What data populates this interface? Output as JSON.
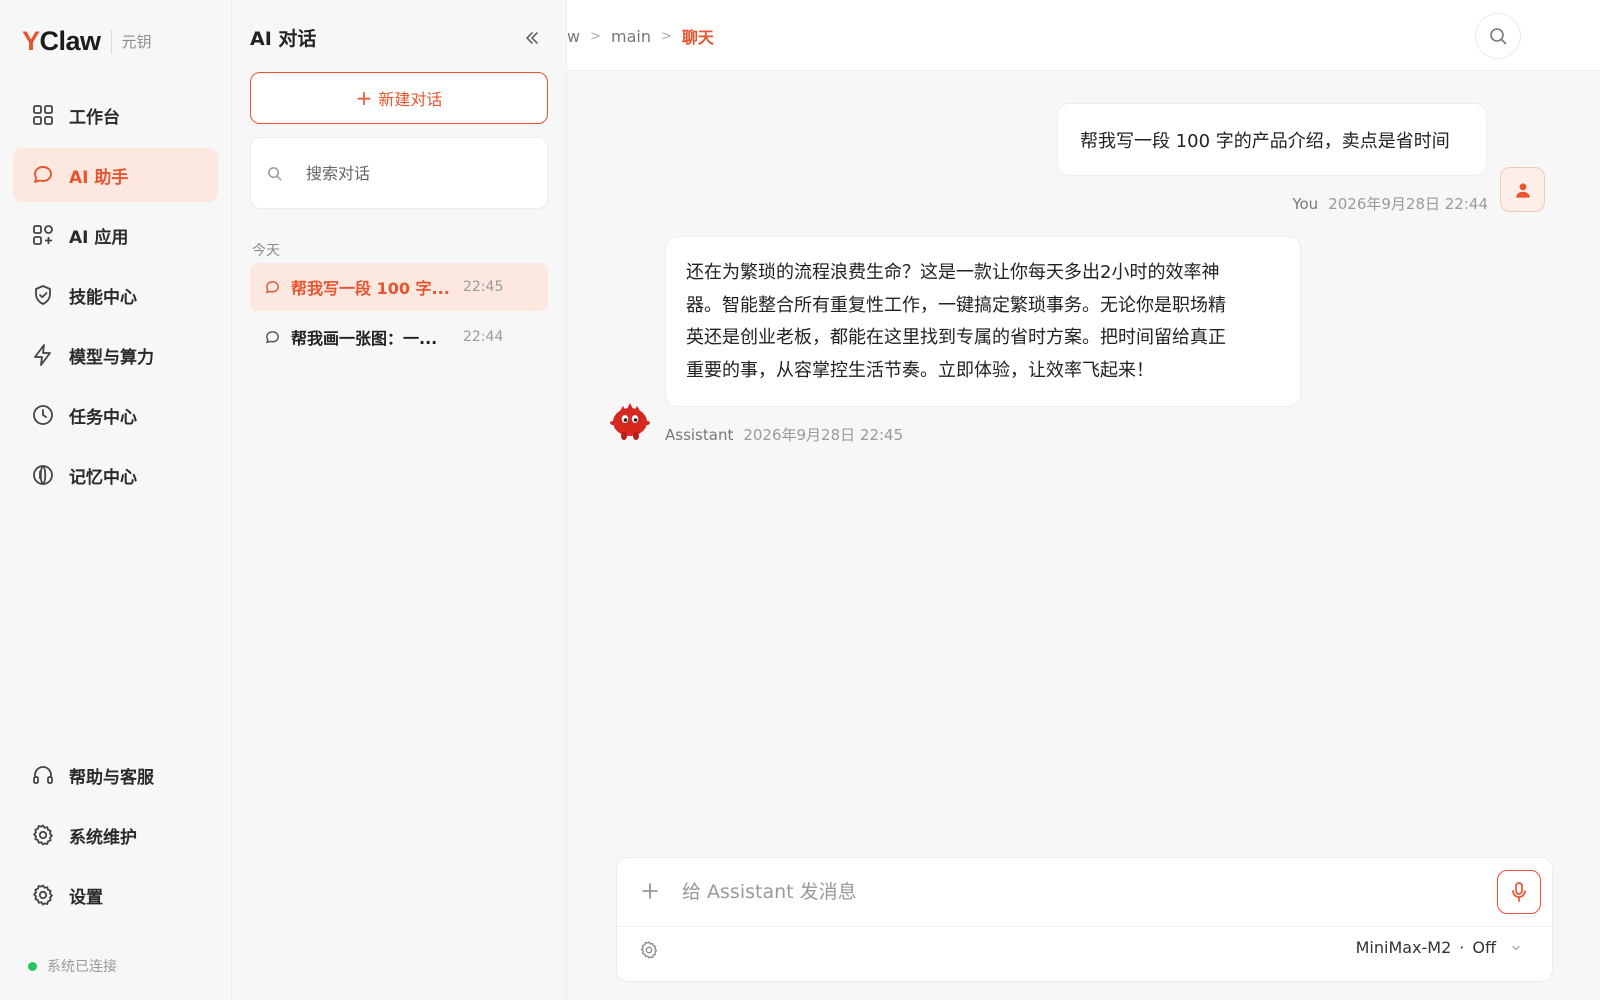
{
  "brand": {
    "logo_y": "Y",
    "logo_rest": "Claw",
    "subtitle": "元钥"
  },
  "nav": {
    "items": [
      {
        "label": "工作台",
        "icon": "grid-icon"
      },
      {
        "label": "AI 助手",
        "icon": "chat-bubble-icon",
        "active": true
      },
      {
        "label": "AI 应用",
        "icon": "apps-icon"
      },
      {
        "label": "技能中心",
        "icon": "shield-icon"
      },
      {
        "label": "模型与算力",
        "icon": "lightning-icon"
      },
      {
        "label": "任务中心",
        "icon": "clock-icon"
      },
      {
        "label": "记忆中心",
        "icon": "memory-icon"
      }
    ],
    "bottom": [
      {
        "label": "帮助与客服",
        "icon": "headset-icon"
      },
      {
        "label": "系统维护",
        "icon": "gear-icon"
      },
      {
        "label": "设置",
        "icon": "gear-icon"
      }
    ],
    "status": "系统已连接"
  },
  "conversations": {
    "title": "AI 对话",
    "new_button": "新建对话",
    "search_placeholder": "搜索对话",
    "section": "今天",
    "items": [
      {
        "title": "帮我写一段 100 字...",
        "time": "22:45",
        "active": true
      },
      {
        "title": "帮我画一张图：一...",
        "time": "22:44"
      }
    ]
  },
  "breadcrumb": {
    "prev": "w",
    "mid": "main",
    "current": "聊天"
  },
  "messages": {
    "user": {
      "text": "帮我写一段 100 字的产品介绍，卖点是省时间",
      "who": "You",
      "time": "2026年9月28日 22:44"
    },
    "assistant": {
      "lines": [
        "还在为繁琐的流程浪费生命？这是一款让你每天多出2小时的效率神",
        "器。智能整合所有重复性工作，一键搞定繁琐事务。无论你是职场精",
        "英还是创业老板，都能在这里找到专属的省时方案。把时间留给真正",
        "重要的事，从容掌控生活节奏。立即体验，让效率飞起来！"
      ],
      "who": "Assistant",
      "time": "2026年9月28日 22:45"
    }
  },
  "composer": {
    "placeholder": "给 Assistant 发消息",
    "model": "MiniMax-M2",
    "thinking": "Off"
  },
  "colors": {
    "accent": "#e8542f",
    "accent_soft": "#fde8e0",
    "status_ok": "#22c55e"
  }
}
